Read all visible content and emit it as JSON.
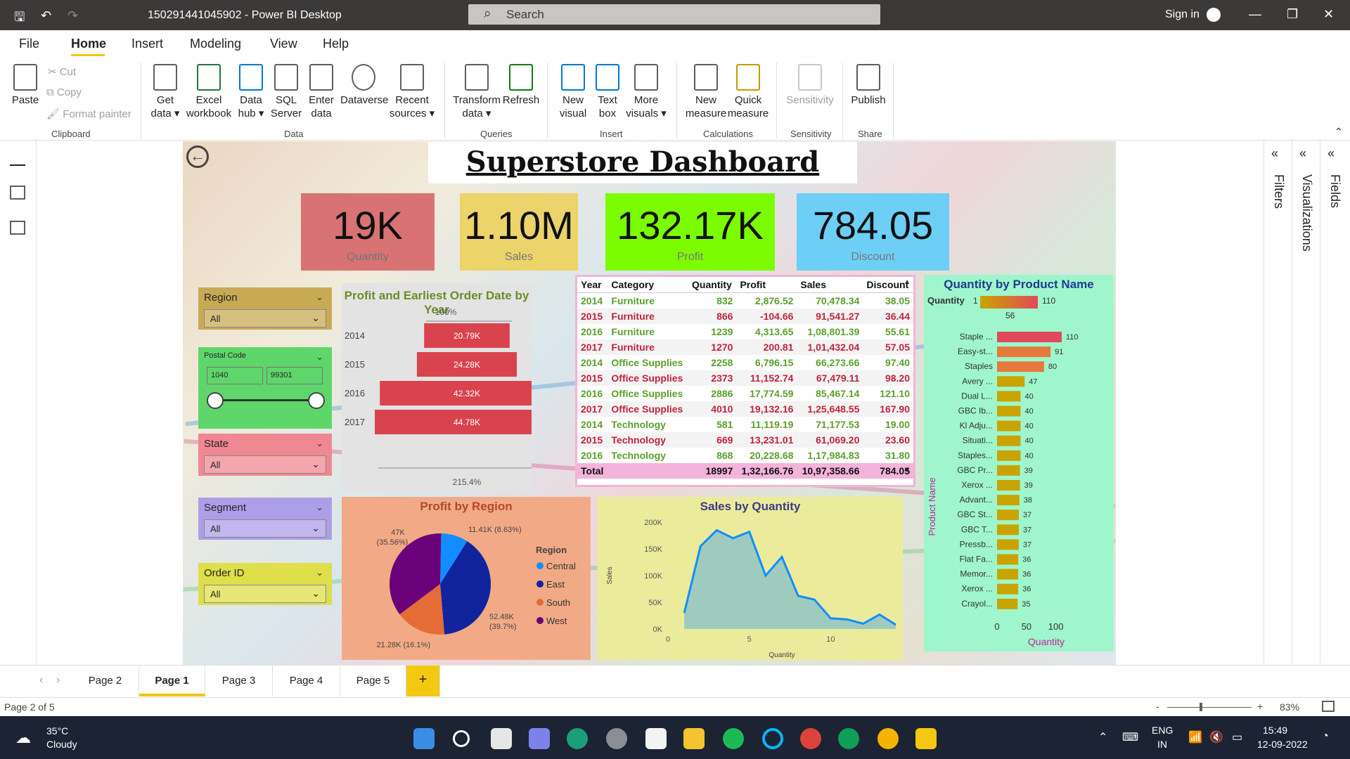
{
  "window": {
    "title": "150291441045902 - Power BI Desktop",
    "search_placeholder": "Search",
    "signin": "Sign in"
  },
  "menu": [
    "File",
    "Home",
    "Insert",
    "Modeling",
    "View",
    "Help"
  ],
  "ribbon": {
    "clipboard": {
      "paste": "Paste",
      "cut": "Cut",
      "copy": "Copy",
      "format_painter": "Format painter",
      "group": "Clipboard"
    },
    "data": {
      "buttons": [
        {
          "l1": "Get",
          "l2": "data ▾"
        },
        {
          "l1": "Excel",
          "l2": "workbook"
        },
        {
          "l1": "Data",
          "l2": "hub ▾"
        },
        {
          "l1": "SQL",
          "l2": "Server"
        },
        {
          "l1": "Enter",
          "l2": "data"
        },
        {
          "l1": "Dataverse",
          "l2": ""
        },
        {
          "l1": "Recent",
          "l2": "sources ▾"
        }
      ],
      "group": "Data"
    },
    "queries": {
      "buttons": [
        {
          "l1": "Transform",
          "l2": "data ▾"
        },
        {
          "l1": "Refresh",
          "l2": ""
        }
      ],
      "group": "Queries"
    },
    "insert": {
      "buttons": [
        {
          "l1": "New",
          "l2": "visual"
        },
        {
          "l1": "Text",
          "l2": "box"
        },
        {
          "l1": "More",
          "l2": "visuals ▾"
        }
      ],
      "group": "Insert"
    },
    "calculations": {
      "buttons": [
        {
          "l1": "New",
          "l2": "measure"
        },
        {
          "l1": "Quick",
          "l2": "measure"
        }
      ],
      "group": "Calculations"
    },
    "sensitivity": {
      "button": "Sensitivity",
      "group": "Sensitivity"
    },
    "share": {
      "button": "Publish",
      "group": "Share"
    }
  },
  "dashboard": {
    "title": "Superstore Dashboard",
    "kpis": [
      {
        "value": "19K",
        "label": "Quantity",
        "bg": "#d97373"
      },
      {
        "value": "1.10M",
        "label": "Sales",
        "bg": "#ecd36a"
      },
      {
        "value": "132.17K",
        "label": "Profit",
        "bg": "#7cfc00"
      },
      {
        "value": "784.05",
        "label": "Discount",
        "bg": "#6dcff6"
      }
    ],
    "slicers": {
      "region": {
        "label": "Region",
        "value": "All",
        "bg": "#c8aa55"
      },
      "postal": {
        "label": "Postal Code",
        "min": "1040",
        "max": "99301",
        "bg": "#5fd66b"
      },
      "state": {
        "label": "State",
        "value": "All",
        "bg": "#f08892"
      },
      "segment": {
        "label": "Segment",
        "value": "All",
        "bg": "#ad9ee8"
      },
      "order": {
        "label": "Order ID",
        "value": "All",
        "bg": "#dedf4a"
      }
    }
  },
  "chart_data": [
    {
      "type": "bar",
      "title": "Profit and Earliest Order Date by Year",
      "top_label": "100%",
      "bottom_label": "215.4%",
      "categories": [
        "2014",
        "2015",
        "2016",
        "2017"
      ],
      "values": [
        20.79,
        24.28,
        42.32,
        44.78
      ],
      "labels": [
        "20.79K",
        "24.28K",
        "42.32K",
        "44.78K"
      ],
      "color": "#d9434e"
    },
    {
      "type": "table",
      "columns": [
        "Year",
        "Category",
        "Quantity",
        "Profit",
        "Sales",
        "Discount"
      ],
      "rows": [
        [
          "2014",
          "Furniture",
          "832",
          "2,876.52",
          "70,478.34",
          "38.05"
        ],
        [
          "2015",
          "Furniture",
          "866",
          "-104.66",
          "91,541.27",
          "36.44"
        ],
        [
          "2016",
          "Furniture",
          "1239",
          "4,313.65",
          "1,08,801.39",
          "55.61"
        ],
        [
          "2017",
          "Furniture",
          "1270",
          "200.81",
          "1,01,432.04",
          "57.05"
        ],
        [
          "2014",
          "Office Supplies",
          "2258",
          "6,796.15",
          "66,273.66",
          "97.40"
        ],
        [
          "2015",
          "Office Supplies",
          "2373",
          "11,152.74",
          "67,479.11",
          "98.20"
        ],
        [
          "2016",
          "Office Supplies",
          "2886",
          "17,774.59",
          "85,467.14",
          "121.10"
        ],
        [
          "2017",
          "Office Supplies",
          "4010",
          "19,132.16",
          "1,25,648.55",
          "167.90"
        ],
        [
          "2014",
          "Technology",
          "581",
          "11,119.19",
          "71,177.53",
          "19.00"
        ],
        [
          "2015",
          "Technology",
          "669",
          "13,231.01",
          "61,069.20",
          "23.60"
        ],
        [
          "2016",
          "Technology",
          "868",
          "20,228.68",
          "1,17,984.83",
          "31.80"
        ]
      ],
      "total": [
        "Total",
        "",
        "18997",
        "1,32,166.76",
        "10,97,358.66",
        "784.05"
      ]
    },
    {
      "type": "pie",
      "title": "Profit by Region",
      "legend_title": "Region",
      "slices": [
        {
          "name": "Central",
          "value": 11.41,
          "label": "11.41K (8.63%)",
          "color": "#118dff"
        },
        {
          "name": "East",
          "value": 52.48,
          "label": "52.48K (39.7%)",
          "color": "#12239e"
        },
        {
          "name": "South",
          "value": 21.28,
          "label": "21.28K (16.1%)",
          "color": "#e66c37"
        },
        {
          "name": "West",
          "value": 47,
          "label": "47K (35.56%)",
          "color": "#6b007b"
        }
      ]
    },
    {
      "type": "area",
      "title": "Sales by Quantity",
      "xlabel": "Quantity",
      "ylabel": "Sales",
      "ylim": [
        0,
        200000
      ],
      "yticks": [
        "0K",
        "50K",
        "100K",
        "150K",
        "200K"
      ],
      "xticks": [
        "0",
        "5",
        "10"
      ],
      "x": [
        1,
        2,
        3,
        4,
        5,
        6,
        7,
        8,
        9,
        10,
        11,
        12,
        13,
        14
      ],
      "y": [
        30000,
        155000,
        185000,
        170000,
        182000,
        100000,
        135000,
        62000,
        55000,
        20000,
        18000,
        10000,
        27000,
        8000
      ],
      "color": "#118dff"
    },
    {
      "type": "bar",
      "title": "Quantity by Product Name",
      "xlabel": "Quantity",
      "ylabel": "Product Name",
      "legend_label": "Quantity",
      "legend_min": "1",
      "legend_mid": "56",
      "legend_max": "110",
      "xticks": [
        "0",
        "50",
        "100"
      ],
      "xlim": [
        0,
        110
      ],
      "categories": [
        "Staple ...",
        "Easy-st...",
        "Staples",
        "Avery ...",
        "Dual L...",
        "GBC Ib...",
        "Kl Adju...",
        "Situati...",
        "Staples...",
        "GBC Pr...",
        "Xerox ...",
        "Advant...",
        "GBC St...",
        "GBC T...",
        "Pressb...",
        "Flat Fa...",
        "Memor...",
        "Xerox ...",
        "Crayol..."
      ],
      "values": [
        110,
        91,
        80,
        47,
        40,
        40,
        40,
        40,
        40,
        39,
        39,
        38,
        37,
        37,
        37,
        36,
        36,
        36,
        35
      ]
    }
  ],
  "pages": {
    "tabs": [
      "Page 2",
      "Page 1",
      "Page 3",
      "Page 4",
      "Page 5"
    ],
    "add": "+",
    "status": "Page 2 of 5",
    "zoom": "83%"
  },
  "right_panes": {
    "filters": "Filters",
    "visualizations": "Visualizations",
    "fields": "Fields"
  },
  "taskbar": {
    "temp": "35°C",
    "weather": "Cloudy",
    "lang1": "ENG",
    "lang2": "IN",
    "time": "15:49",
    "date": "12-09-2022"
  }
}
